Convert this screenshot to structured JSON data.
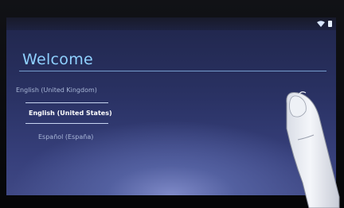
{
  "welcome": {
    "title": "Welcome"
  },
  "languages": {
    "items": [
      {
        "label": "English (United Kingdom)",
        "selected": false
      },
      {
        "label": "English (United States)",
        "selected": true
      },
      {
        "label": "Español (España)",
        "selected": false
      }
    ]
  },
  "statusbar": {
    "icons": [
      "wifi-icon",
      "battery-icon"
    ]
  },
  "colors": {
    "title": "#8fd1ff",
    "selected_text": "#ffffff",
    "unselected_text": "#a8b6d6",
    "screen_top": "#20264b",
    "screen_bottom": "#3f4884"
  }
}
